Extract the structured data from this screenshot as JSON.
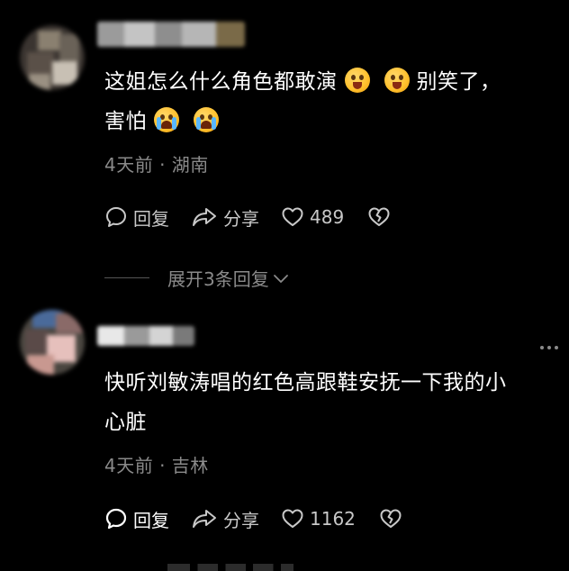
{
  "comments": [
    {
      "text_parts": [
        "这姐怎么什么角色都敢演",
        "别笑了，",
        "害怕"
      ],
      "emojis": [
        "laugh-cry-emoji",
        "laugh-cry-emoji",
        "crying-emoji",
        "crying-emoji"
      ],
      "meta": "4天前 · 湖南",
      "reply_label": "回复",
      "share_label": "分享",
      "likes": "489",
      "expand_label": "展开3条回复"
    },
    {
      "text_line1": "快听刘敏涛唱的红色高跟鞋安抚一下我的小",
      "text_line2": "心脏",
      "meta": "4天前 · 吉林",
      "reply_label": "回复",
      "share_label": "分享",
      "likes": "1162"
    }
  ],
  "colors": {
    "background": "#000000",
    "text": "#ffffff",
    "meta": "#8a8a8a",
    "action": "#c8c8c8"
  }
}
